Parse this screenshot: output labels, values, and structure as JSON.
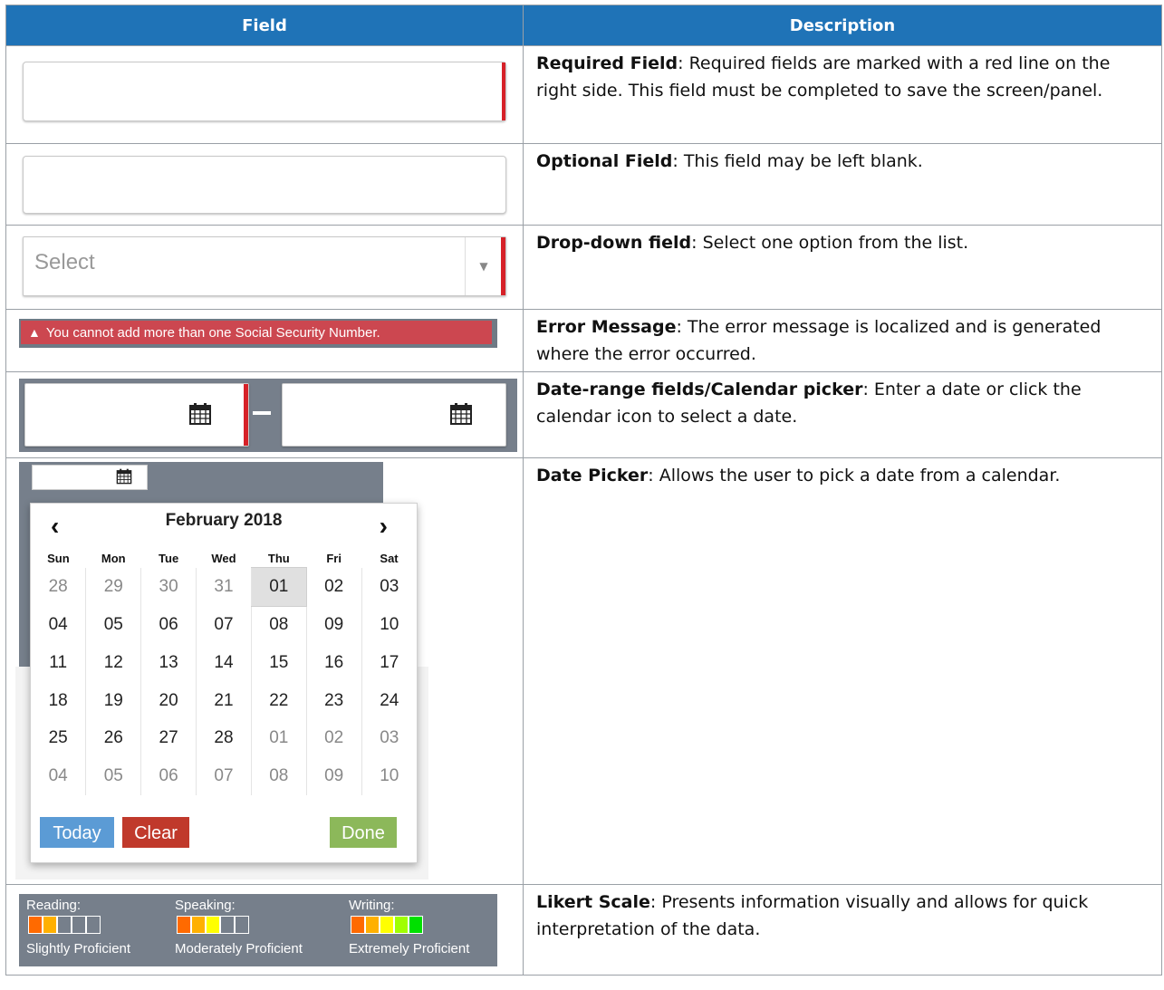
{
  "table": {
    "headers": {
      "field": "Field",
      "description": "Description"
    },
    "rows": [
      {
        "term": "Required Field",
        "text": ": Required fields are marked with a red line on the right side. This field must be completed to save the screen/panel."
      },
      {
        "term": "Optional Field",
        "text": ": This field may be left blank."
      },
      {
        "term": "Drop-down field",
        "text": ": Select one option from the list."
      },
      {
        "term": "Error Message",
        "text": ": The error message is localized and is generated where the error occurred."
      },
      {
        "term": "Date-range fields/Calendar picker",
        "text": ":  Enter a date or click the calendar icon to select a date."
      },
      {
        "term": "Date Picker",
        "text": ":  Allows the user to pick a date from a calendar."
      },
      {
        "term": "Likert Scale",
        "text": ": Presents information visually and allows for quick interpretation of the data."
      }
    ]
  },
  "dropdown": {
    "placeholder": "Select"
  },
  "error_message": {
    "text": "You cannot add more than one Social Security Number."
  },
  "datepicker": {
    "month_label": "February 2018",
    "weekdays": [
      "Sun",
      "Mon",
      "Tue",
      "Wed",
      "Thu",
      "Fri",
      "Sat"
    ],
    "weeks": [
      [
        "28",
        "29",
        "30",
        "31",
        "01",
        "02",
        "03"
      ],
      [
        "04",
        "05",
        "06",
        "07",
        "08",
        "09",
        "10"
      ],
      [
        "11",
        "12",
        "13",
        "14",
        "15",
        "16",
        "17"
      ],
      [
        "18",
        "19",
        "20",
        "21",
        "22",
        "23",
        "24"
      ],
      [
        "25",
        "26",
        "27",
        "28",
        "01",
        "02",
        "03"
      ],
      [
        "04",
        "05",
        "06",
        "07",
        "08",
        "09",
        "10"
      ]
    ],
    "selected": "01",
    "buttons": {
      "today": "Today",
      "clear": "Clear",
      "done": "Done"
    },
    "colors": {
      "today": "#5b9bd5",
      "clear": "#c0392b",
      "done": "#8cb85a"
    }
  },
  "likert": [
    {
      "label": "Reading:",
      "level_text": "Slightly Proficient",
      "filled": 2,
      "total": 5
    },
    {
      "label": "Speaking:",
      "level_text": "Moderately Proficient",
      "filled": 3,
      "total": 5
    },
    {
      "label": "Writing:",
      "level_text": "Extremely Proficient",
      "filled": 5,
      "total": 5
    }
  ],
  "likert_colors": [
    "#ff6a00",
    "#ffb000",
    "#ffff00",
    "#a0ff00",
    "#00e000"
  ],
  "colors": {
    "header_bg": "#1f73b7",
    "required_marker": "#d62128",
    "panel_gray": "#767f8b",
    "error_bg": "#cc4750"
  }
}
